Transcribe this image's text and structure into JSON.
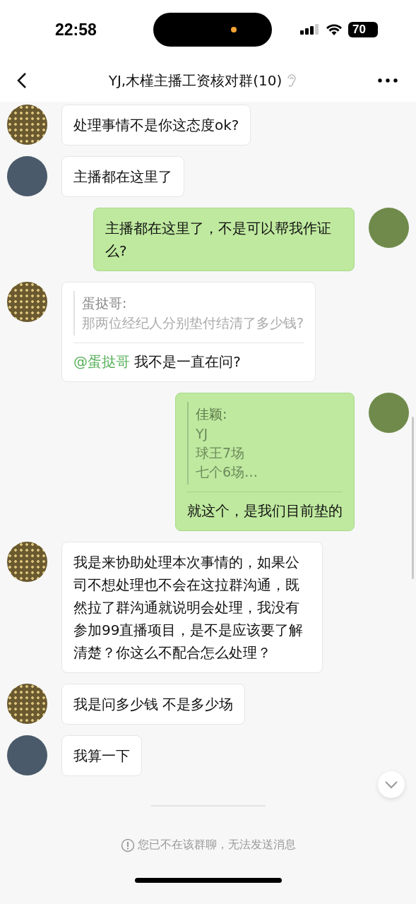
{
  "status_bar": {
    "time": "22:58",
    "battery": "70"
  },
  "header": {
    "title": "YJ,木槿主播工资核对群(10)"
  },
  "messages": [
    {
      "kind": "text",
      "outgoing": false,
      "avatar": {
        "kind": "pattern"
      },
      "text": "处理事情不是你这态度ok?"
    },
    {
      "kind": "text",
      "outgoing": false,
      "avatar": {
        "kind": "photo"
      },
      "text": "主播都在这里了"
    },
    {
      "kind": "text",
      "outgoing": true,
      "avatar": {
        "kind": "photo"
      },
      "text": "主播都在这里了，不是可以帮我作证么?"
    },
    {
      "kind": "quote",
      "outgoing": false,
      "avatar": {
        "kind": "pattern"
      },
      "quote_name": "蛋挞哥:",
      "quote_lines": [
        "那两位经纪人分别垫付结清了多少钱?"
      ],
      "mention": "@蛋挞哥",
      "text": "我不是一直在问?"
    },
    {
      "kind": "quote",
      "outgoing": true,
      "avatar": {
        "kind": "photo"
      },
      "quote_name": "佳颖:",
      "quote_lines": [
        "YJ",
        "球王7场",
        "七个6场…"
      ],
      "text": "就这个，是我们目前垫的"
    },
    {
      "kind": "text",
      "outgoing": false,
      "avatar": {
        "kind": "pattern"
      },
      "text": "我是来协助处理本次事情的，如果公司不想处理也不会在这拉群沟通，既然拉了群沟通就说明会处理，我没有参加99直播项目，是不是应该要了解清楚？你这么不配合怎么处理？"
    },
    {
      "kind": "text",
      "outgoing": false,
      "avatar": {
        "kind": "pattern"
      },
      "text": "我是问多少钱 不是多少场"
    },
    {
      "kind": "text",
      "outgoing": false,
      "avatar": {
        "kind": "photo"
      },
      "text": "我算一下"
    }
  ],
  "notice": "您已不在该群聊，无法发送消息"
}
